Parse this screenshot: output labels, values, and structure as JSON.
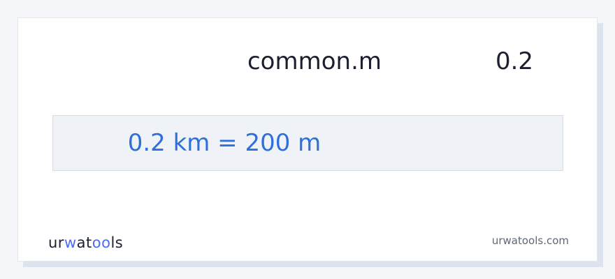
{
  "converter": {
    "unit_label": "common.m",
    "input_value": "0.2",
    "result": "0.2 km = 200 m"
  },
  "footer": {
    "logo_text": "urwatools",
    "site": "urwatools.com"
  },
  "colors": {
    "result_text": "#2f6fdb",
    "result_background": "#eff3f8",
    "logo_accent": "#4a6cf7",
    "text_dark": "#1b1f2e",
    "muted_text": "#5d6877"
  }
}
